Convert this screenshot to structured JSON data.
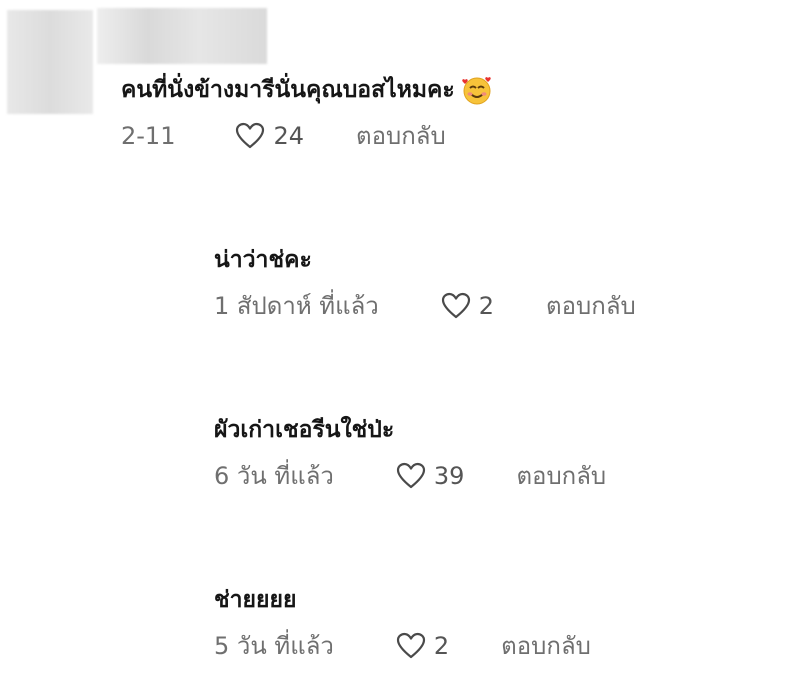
{
  "comments": [
    {
      "text": "คนที่นั่งข้างมารีนั่นคุณบอสไหมคะ",
      "emoji": "smiling-face-with-hearts",
      "time": "2-11",
      "likes": "24",
      "reply": "ตอบกลับ"
    },
    {
      "text": "น่าว่าช่คะ",
      "time": "1 สัปดาห์ ที่แล้ว",
      "likes": "2",
      "reply": "ตอบกลับ"
    },
    {
      "text": "ผัวเก่าเชอรีนใช่ป่ะ",
      "time": "6 วัน ที่แล้ว",
      "likes": "39",
      "reply": "ตอบกลับ"
    },
    {
      "text": "ช่ายยยย",
      "time": "5 วัน ที่แล้ว",
      "likes": "2",
      "reply": "ตอบกลับ"
    }
  ]
}
